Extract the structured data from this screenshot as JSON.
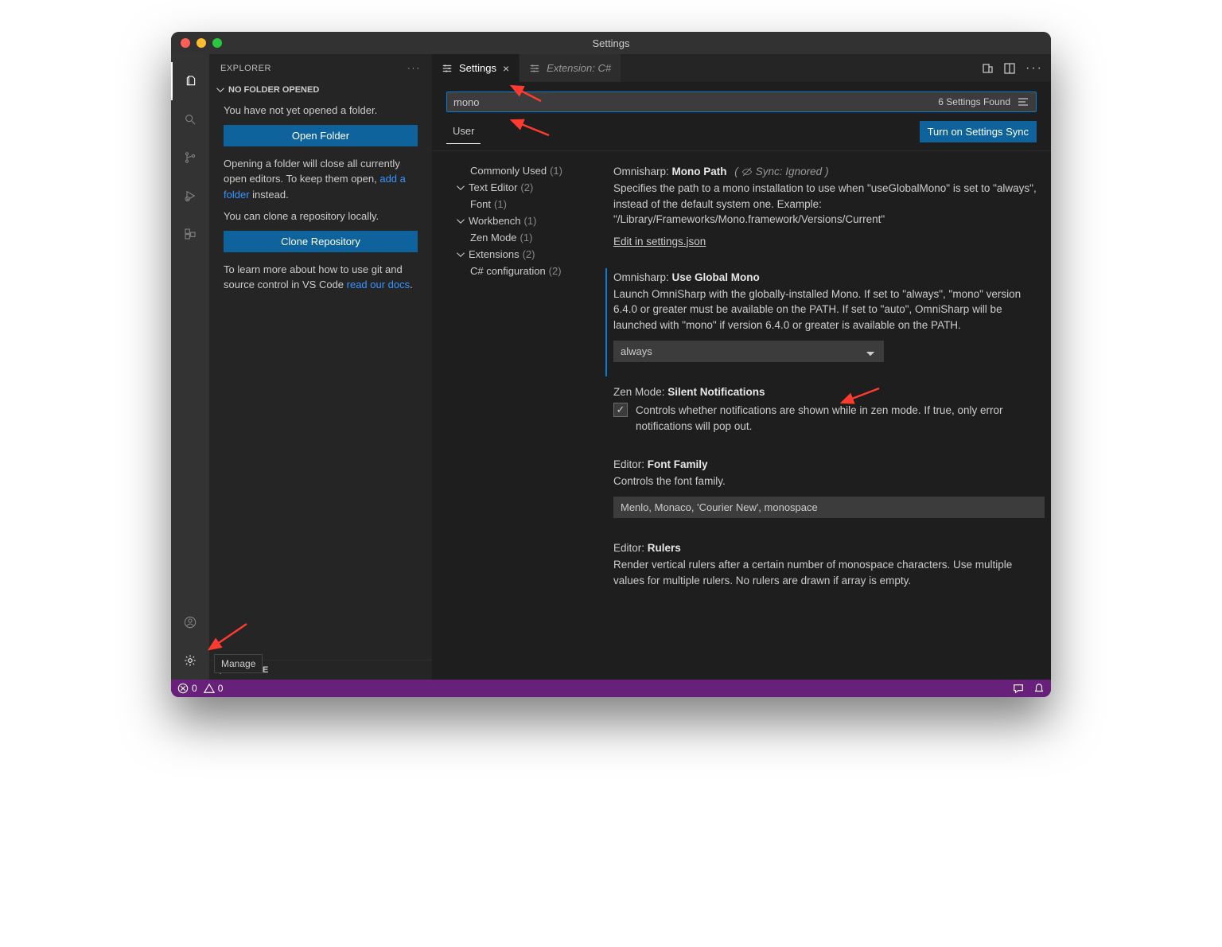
{
  "window_title": "Settings",
  "activitybar": {
    "items": [
      "files-icon",
      "search-icon",
      "source-control-icon",
      "debug-icon",
      "extensions-icon"
    ],
    "bottom": [
      "account-icon",
      "gear-icon"
    ]
  },
  "tooltip_manage": "Manage",
  "sidebar": {
    "title": "EXPLORER",
    "section": "NO FOLDER OPENED",
    "no_folder_msg": "You have not yet opened a folder.",
    "open_folder_btn": "Open Folder",
    "open_warn_pre": "Opening a folder will close all currently open editors. To keep them open, ",
    "open_warn_link": "add a folder",
    "open_warn_post": " instead.",
    "clone_msg": "You can clone a repository locally.",
    "clone_btn": "Clone Repository",
    "learn_pre": "To learn more about how to use git and source control in VS Code ",
    "learn_link": "read our docs",
    "learn_post": ".",
    "outline": "OUTLINE"
  },
  "tabs": [
    {
      "icon": "settings-icon",
      "label": "Settings",
      "active": true,
      "closeable": true,
      "italic": false
    },
    {
      "icon": "settings-icon",
      "label": "Extension: C#",
      "active": false,
      "closeable": false,
      "italic": true
    }
  ],
  "search": {
    "value": "mono",
    "found": "6 Settings Found"
  },
  "scope": {
    "label": "User"
  },
  "sync_btn": "Turn on Settings Sync",
  "toc": [
    {
      "label": "Commonly Used",
      "count": "(1)",
      "expandable": false,
      "indent": 1
    },
    {
      "label": "Text Editor",
      "count": "(2)",
      "expandable": true,
      "indent": 0
    },
    {
      "label": "Font",
      "count": "(1)",
      "expandable": false,
      "indent": 1
    },
    {
      "label": "Workbench",
      "count": "(1)",
      "expandable": true,
      "indent": 0
    },
    {
      "label": "Zen Mode",
      "count": "(1)",
      "expandable": false,
      "indent": 1
    },
    {
      "label": "Extensions",
      "count": "(2)",
      "expandable": true,
      "indent": 0
    },
    {
      "label": "C# configuration",
      "count": "(2)",
      "expandable": false,
      "indent": 1
    }
  ],
  "settings": {
    "monoPath": {
      "scope": "Omnisharp: ",
      "key": "Mono Path",
      "ignored": "Sync: Ignored",
      "desc": "Specifies the path to a mono installation to use when \"useGlobalMono\" is set to \"always\", instead of the default system one. Example: \"/Library/Frameworks/Mono.framework/Versions/Current\"",
      "edit": "Edit in settings.json"
    },
    "useGlobalMono": {
      "scope": "Omnisharp: ",
      "key": "Use Global Mono",
      "desc": "Launch OmniSharp with the globally-installed Mono. If set to \"always\", \"mono\" version 6.4.0 or greater must be available on the PATH. If set to \"auto\", OmniSharp will be launched with \"mono\" if version 6.4.0 or greater is available on the PATH.",
      "value": "always"
    },
    "zen": {
      "scope": "Zen Mode: ",
      "key": "Silent Notifications",
      "desc": "Controls whether notifications are shown while in zen mode. If true, only error notifications will pop out.",
      "checked": true
    },
    "fontFamily": {
      "scope": "Editor: ",
      "key": "Font Family",
      "desc": "Controls the font family.",
      "value": "Menlo, Monaco, 'Courier New', monospace"
    },
    "rulers": {
      "scope": "Editor: ",
      "key": "Rulers",
      "desc": "Render vertical rulers after a certain number of monospace characters. Use multiple values for multiple rulers. No rulers are drawn if array is empty."
    }
  },
  "status": {
    "errors": "0",
    "warnings": "0"
  }
}
